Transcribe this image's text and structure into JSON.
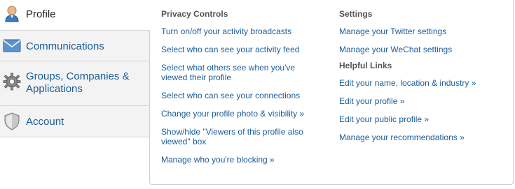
{
  "sidebar": {
    "items": [
      {
        "label": "Profile",
        "icon": "profile-person-icon",
        "active": true
      },
      {
        "label": "Communications",
        "icon": "envelope-icon",
        "active": false
      },
      {
        "label": "Groups, Companies & Applications",
        "icon": "gear-icon",
        "active": false
      },
      {
        "label": "Account",
        "icon": "shield-icon",
        "active": false
      }
    ]
  },
  "privacy": {
    "heading": "Privacy Controls",
    "links": [
      "Turn on/off your activity broadcasts",
      "Select who can see your activity feed",
      "Select what others see when you've viewed their profile",
      "Select who can see your connections",
      "Change your profile photo & visibility »",
      "Show/hide \"Viewers of this profile also viewed\" box",
      "Manage who you're blocking »"
    ]
  },
  "settings": {
    "heading": "Settings",
    "links": [
      "Manage your Twitter settings",
      "Manage your WeChat settings"
    ]
  },
  "helpful": {
    "heading": "Helpful Links",
    "links": [
      "Edit your name, location & industry »",
      "Edit your profile »",
      "Edit your public profile »",
      "Manage your recommendations »"
    ]
  },
  "colors": {
    "link": "#1a5c99",
    "heading": "#555555",
    "tab_bg": "#f3f3f3",
    "border": "#cfcfcf"
  }
}
